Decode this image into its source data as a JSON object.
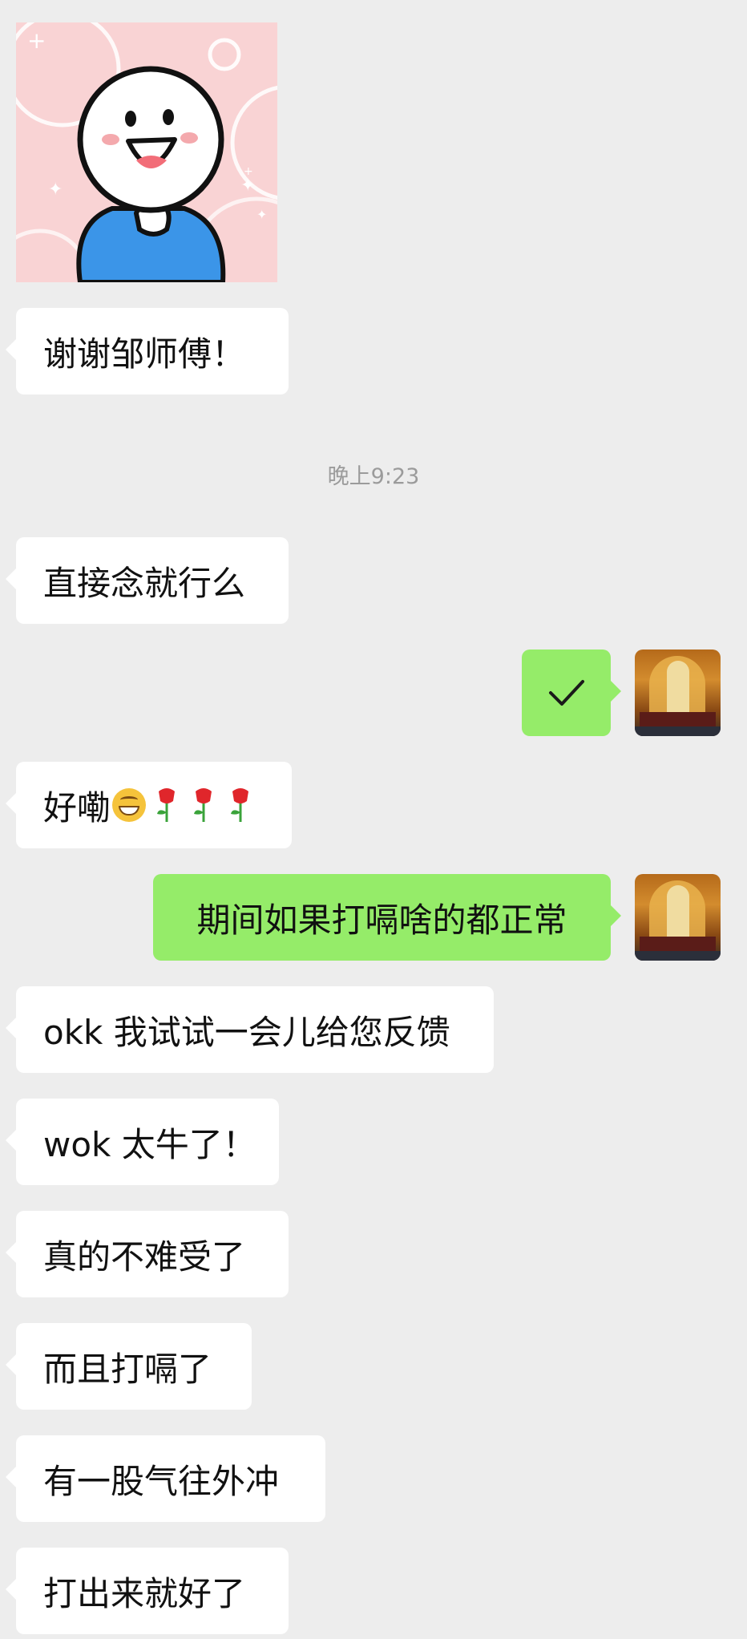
{
  "messages": {
    "m1": "谢谢邹师傅！",
    "m2": "直接念就行么",
    "m4": "好嘞",
    "m5": "期间如果打嗝啥的都正常",
    "m6": "okk 我试试一会儿给您反馈",
    "m7": "wok 太牛了！",
    "m8": "真的不难受了",
    "m9": "而且打嗝了",
    "m10": "有一股气往外冲",
    "m11": "打出来就好了"
  },
  "timestamp": "晚上9:23",
  "icons": {
    "check": "check-icon",
    "grin": "grinning-face-emoji",
    "rose": "rose-emoji"
  },
  "colors": {
    "background": "#ededed",
    "incoming": "#ffffff",
    "outgoing": "#95ec69",
    "timestamp": "#9b9b9b"
  }
}
